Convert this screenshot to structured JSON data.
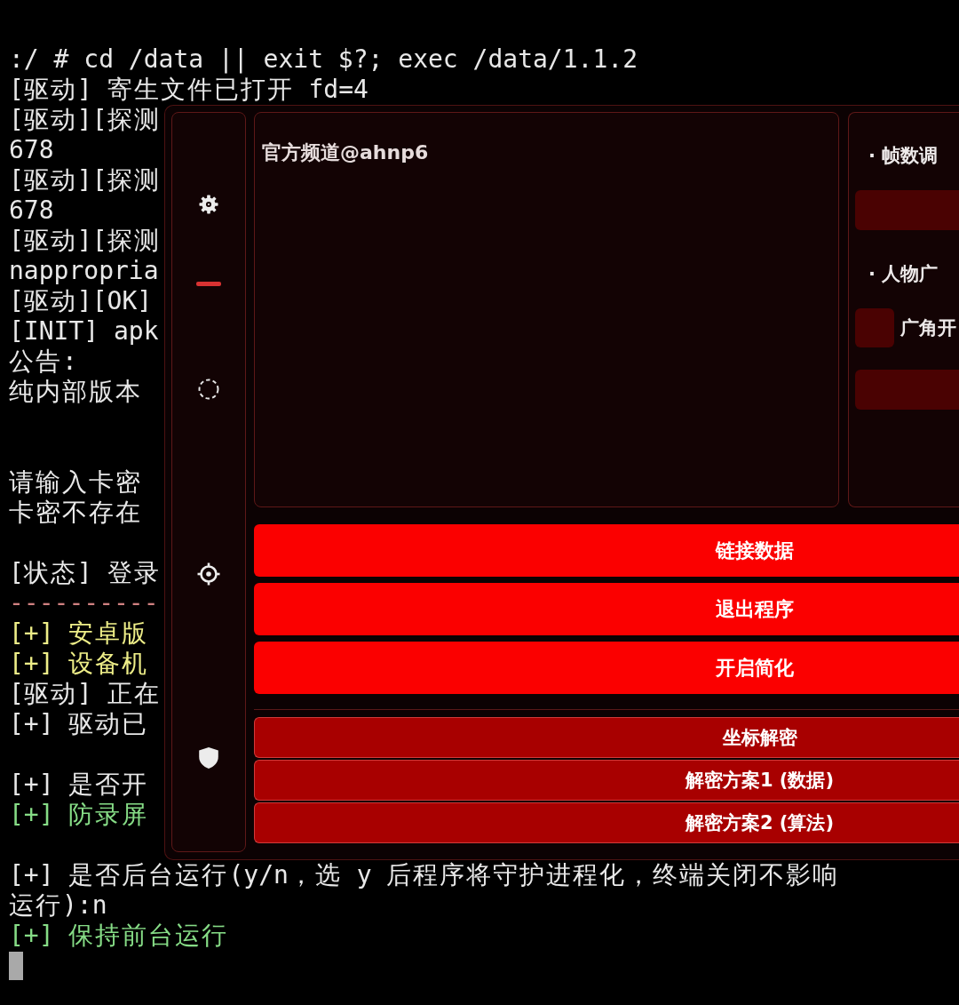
{
  "terminal": {
    "lines": [
      {
        "kind": "text",
        "text": ":/ # cd /data || exit $?; exec /data/1.1.2",
        "color": "#e8e8e8"
      },
      {
        "kind": "text",
        "text": "[驱动] 寄生文件已打开 fd=4",
        "color": "#e8e8e8"
      },
      {
        "kind": "text",
        "text": "[驱动][探测",
        "color": "#e8e8e8"
      },
      {
        "kind": "text",
        "text": "678",
        "color": "#e8e8e8"
      },
      {
        "kind": "text",
        "text": "[驱动][探测",
        "color": "#e8e8e8"
      },
      {
        "kind": "text",
        "text": "678",
        "color": "#e8e8e8"
      },
      {
        "kind": "text",
        "text": "[驱动][探测",
        "color": "#e8e8e8"
      },
      {
        "kind": "text",
        "text": "nappropria",
        "color": "#e8e8e8"
      },
      {
        "kind": "text",
        "text": "[驱动][OK]",
        "color": "#e8e8e8"
      },
      {
        "kind": "text",
        "text": "[INIT] apk",
        "color": "#e8e8e8"
      },
      {
        "kind": "text",
        "text": "公告:",
        "color": "#e8e8e8"
      },
      {
        "kind": "text",
        "text": "纯内部版本",
        "color": "#e8e8e8"
      },
      {
        "kind": "blank"
      },
      {
        "kind": "blank"
      },
      {
        "kind": "text",
        "text": "请输入卡密",
        "color": "#e8e8e8"
      },
      {
        "kind": "text",
        "text": "卡密不存在",
        "color": "#e8e8e8"
      },
      {
        "kind": "blank"
      },
      {
        "kind": "text",
        "text": "[状态] 登录",
        "color": "#e8e8e8"
      },
      {
        "kind": "text",
        "text": "----------",
        "color": "#d08080"
      },
      {
        "kind": "text",
        "text": "[+] 安卓版",
        "color": "#eeee88"
      },
      {
        "kind": "text",
        "text": "[+] 设备机",
        "color": "#eeee88"
      },
      {
        "kind": "text",
        "text": "[驱动] 正在",
        "color": "#e8e8e8"
      },
      {
        "kind": "text",
        "text": "[+] 驱动已",
        "color": "#e8e8e8"
      },
      {
        "kind": "blank"
      },
      {
        "kind": "text",
        "text": "[+] 是否开",
        "color": "#e8e8e8"
      },
      {
        "kind": "text",
        "text": "[+] 防录屏",
        "color": "#86dc86"
      },
      {
        "kind": "blank"
      },
      {
        "kind": "text",
        "text": "[+] 是否后台运行(y/n，选 y 后程序将守护进程化，终端关闭不影响",
        "color": "#e8e8e8"
      },
      {
        "kind": "text",
        "text": "运行):n",
        "color": "#e8e8e8"
      },
      {
        "kind": "text",
        "text": "[+] 保持前台运行",
        "color": "#86dc86"
      }
    ]
  },
  "overlay": {
    "sidebar": {
      "tabs": [
        {
          "selected": true
        },
        {
          "selected": false
        },
        {
          "selected": false
        },
        {
          "selected": false
        }
      ]
    },
    "info_panel": {
      "text": "官方频道@ahnp6"
    },
    "settings_panel": {
      "sections": [
        {
          "heading": "· 帧数调",
          "items": [
            {
              "kind": "field"
            }
          ]
        },
        {
          "heading": "· 人物广",
          "items": [
            {
              "kind": "checkbox",
              "label": "广角开",
              "checked": false
            },
            {
              "kind": "field"
            }
          ]
        }
      ]
    },
    "actions": [
      {
        "label": "链接数据"
      },
      {
        "label": "退出程序"
      },
      {
        "label": "开启简化"
      }
    ],
    "decrypt_options": [
      {
        "label": "坐标解密"
      },
      {
        "label": "解密方案1 (数据)"
      },
      {
        "label": "解密方案2 (算法)"
      }
    ]
  }
}
